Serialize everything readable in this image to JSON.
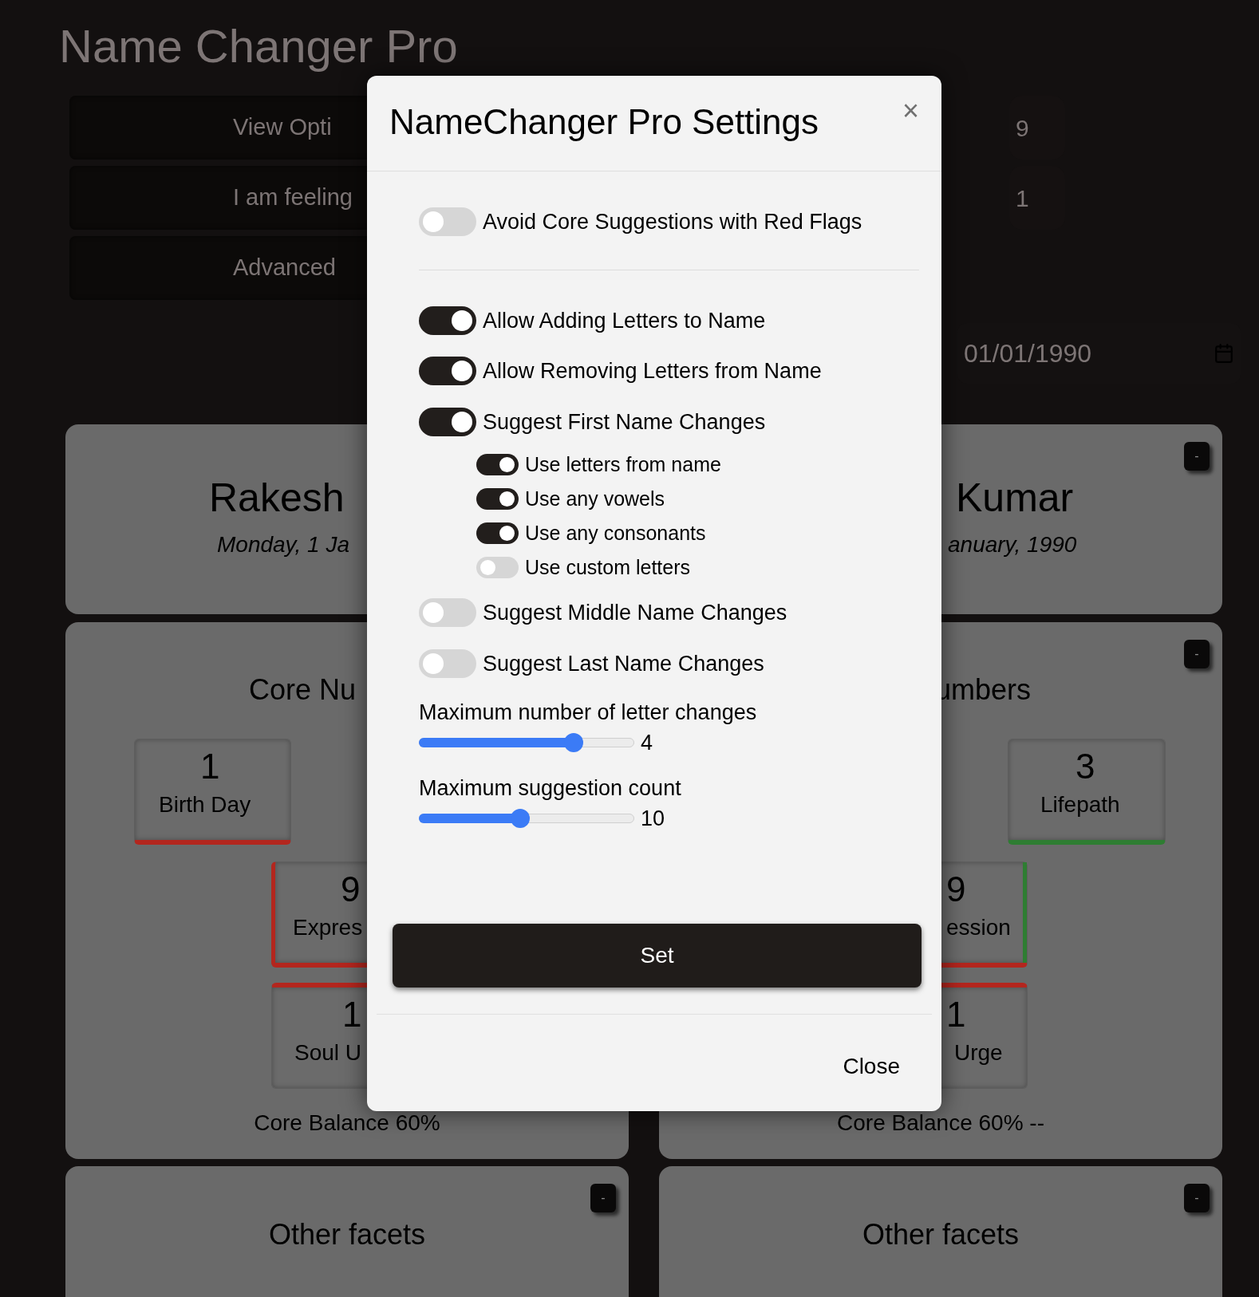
{
  "app_title": "Name Changer Pro",
  "menu_buttons": [
    "View Opti",
    "I am feeling",
    "Advanced"
  ],
  "number_badges": [
    "9",
    "1"
  ],
  "date_field": {
    "value": "01/01/1990"
  },
  "name_cards": [
    {
      "name": "Rakesh",
      "date": "Monday, 1 Ja"
    },
    {
      "name": "Kumar",
      "date": "anuary, 1990",
      "collapse_button": "-"
    }
  ],
  "core_cards": [
    {
      "title": "Core Nu",
      "balance": "Core Balance 60%",
      "tiles": [
        {
          "number": "1",
          "label": "Birth Day",
          "color": "#b3261e"
        },
        {
          "number": "9",
          "label": "Expres",
          "color": "#b3261e"
        },
        {
          "number": "1",
          "label": "Soul U",
          "color": "#b3261e"
        }
      ]
    },
    {
      "title": "umbers",
      "balance": "Core Balance 60% --",
      "collapse_button": "-",
      "tiles": [
        {
          "number": "3",
          "label": "Lifepath",
          "color": "#2e7d32"
        },
        {
          "number": "9",
          "label": "ession",
          "color": "#b3261e",
          "side_accent": {
            "color": "#2e7d32"
          }
        },
        {
          "number": "1",
          "label": "Urge",
          "color": "#b3261e"
        }
      ]
    }
  ],
  "facet_cards": [
    {
      "title": "Other facets",
      "collapse_button": "-"
    },
    {
      "title": "Other facets",
      "collapse_button": "-"
    }
  ],
  "settings_dialog": {
    "title": "NameChanger Pro Settings",
    "close_icon": "×",
    "option_groups": [
      [
        {
          "label": "Avoid Core Suggestions with Red Flags",
          "on": false
        }
      ],
      [
        {
          "label": "Allow Adding Letters to Name",
          "on": true
        },
        {
          "label": "Allow Removing Letters from Name",
          "on": true
        },
        {
          "label": "Suggest First Name Changes",
          "on": true,
          "children": [
            {
              "label": "Use letters from name",
              "on": true
            },
            {
              "label": "Use any vowels",
              "on": true
            },
            {
              "label": "Use any consonants",
              "on": true
            },
            {
              "label": "Use custom letters",
              "on": false
            }
          ]
        },
        {
          "label": "Suggest Middle Name Changes",
          "on": false
        },
        {
          "label": "Suggest Last Name Changes",
          "on": false
        }
      ]
    ],
    "sliders": [
      {
        "label": "Maximum number of letter changes",
        "level": 0.72,
        "reading": "4"
      },
      {
        "label": "Maximum suggestion count",
        "level": 0.47,
        "reading": "10"
      }
    ],
    "set_button": "Set",
    "close_button": "Close"
  }
}
